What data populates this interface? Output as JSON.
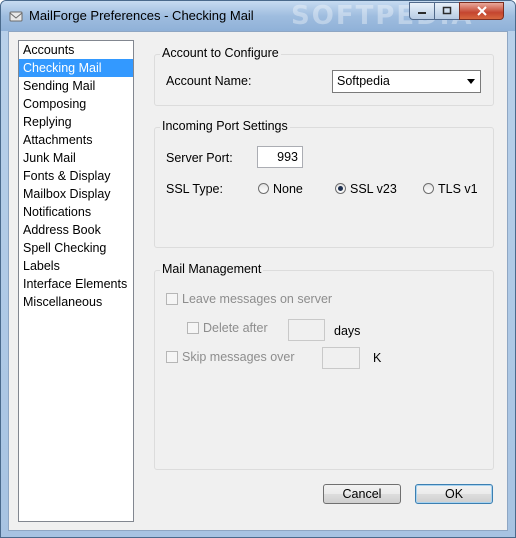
{
  "window": {
    "title": "MailForge Preferences - Checking Mail",
    "watermark": "SOFTPEDIA"
  },
  "sidebar": {
    "items": [
      {
        "label": "Accounts",
        "selected": false
      },
      {
        "label": "Checking Mail",
        "selected": true
      },
      {
        "label": "Sending Mail",
        "selected": false
      },
      {
        "label": "Composing",
        "selected": false
      },
      {
        "label": "Replying",
        "selected": false
      },
      {
        "label": "Attachments",
        "selected": false
      },
      {
        "label": "Junk Mail",
        "selected": false
      },
      {
        "label": "Fonts & Display",
        "selected": false
      },
      {
        "label": "Mailbox Display",
        "selected": false
      },
      {
        "label": "Notifications",
        "selected": false
      },
      {
        "label": "Address Book",
        "selected": false
      },
      {
        "label": "Spell Checking",
        "selected": false
      },
      {
        "label": "Labels",
        "selected": false
      },
      {
        "label": "Interface Elements",
        "selected": false
      },
      {
        "label": "Miscellaneous",
        "selected": false
      }
    ]
  },
  "account_group": {
    "title": "Account to Configure",
    "account_name_label": "Account Name:",
    "account_name_value": "Softpedia"
  },
  "port_group": {
    "title": "Incoming Port Settings",
    "server_port_label": "Server Port:",
    "server_port_value": "993",
    "ssl_type_label": "SSL Type:",
    "ssl_options": [
      {
        "label": "None",
        "selected": false
      },
      {
        "label": "SSL v23",
        "selected": true
      },
      {
        "label": "TLS v1",
        "selected": false
      }
    ]
  },
  "mail_group": {
    "title": "Mail Management",
    "leave_messages_label": "Leave messages on server",
    "leave_messages_checked": false,
    "delete_after_label": "Delete after",
    "delete_after_checked": false,
    "delete_after_value": "",
    "days_label": "days",
    "skip_messages_label": "Skip messages over",
    "skip_messages_checked": false,
    "skip_messages_value": "",
    "k_label": "K"
  },
  "buttons": {
    "cancel": "Cancel",
    "ok": "OK"
  }
}
